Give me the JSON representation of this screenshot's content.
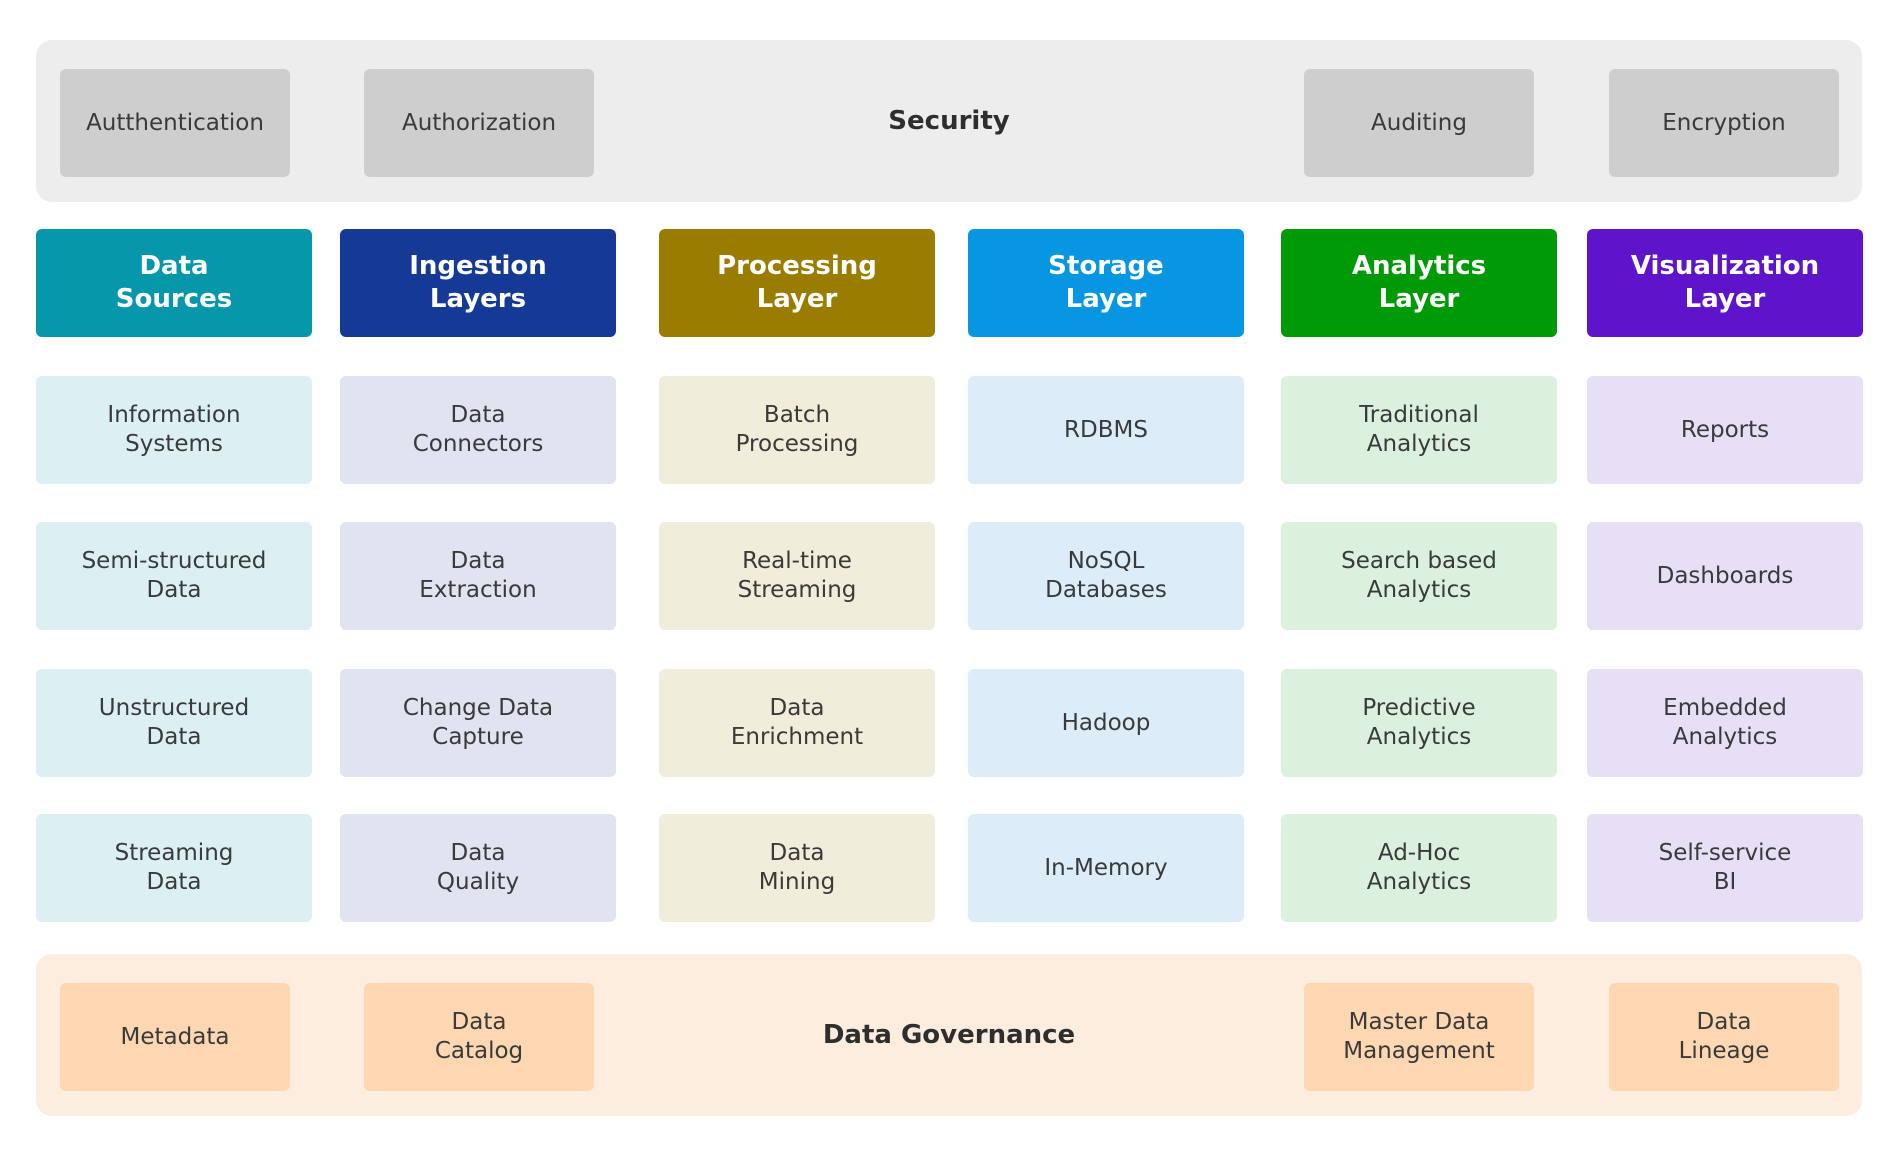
{
  "security": {
    "title": "Security",
    "items": [
      "Autthentication",
      "Authorization",
      "Auditing",
      "Encryption"
    ]
  },
  "columns": [
    {
      "title": "Data\nSources",
      "header_color": "#0797aa",
      "cell_color": "#dcf0f3",
      "items": [
        "Information\nSystems",
        "Semi-structured\nData",
        "Unstructured\nData",
        "Streaming\nData"
      ]
    },
    {
      "title": "Ingestion\nLayers",
      "header_color": "#143a96",
      "cell_color": "#e0e3f0",
      "items": [
        "Data\nConnectors",
        "Data\nExtraction",
        "Change Data\nCapture",
        "Data\nQuality"
      ]
    },
    {
      "title": "Processing\nLayer",
      "header_color": "#9a7d00",
      "cell_color": "#f0edda",
      "items": [
        "Batch\nProcessing",
        "Real-time\nStreaming",
        "Data\nEnrichment",
        "Data\nMining"
      ]
    },
    {
      "title": "Storage\nLayer",
      "header_color": "#0797e2",
      "cell_color": "#dcedf9",
      "items": [
        "RDBMS",
        "NoSQL\nDatabases",
        "Hadoop",
        "In-Memory"
      ]
    },
    {
      "title": "Analytics\nLayer",
      "header_color": "#009a07",
      "cell_color": "#dcf0de",
      "items": [
        "Traditional\nAnalytics",
        "Search based\nAnalytics",
        "Predictive\nAnalytics",
        "Ad-Hoc\nAnalytics"
      ]
    },
    {
      "title": "Visualization\nLayer",
      "header_color": "#5e14cb",
      "cell_color": "#e7dff5",
      "items": [
        "Reports",
        "Dashboards",
        "Embedded\nAnalytics",
        "Self-service\nBI"
      ]
    }
  ],
  "governance": {
    "title": "Data Governance",
    "items": [
      "Metadata",
      "Data\nCatalog",
      "Master Data\nManagement",
      "Data\nLineage"
    ]
  }
}
